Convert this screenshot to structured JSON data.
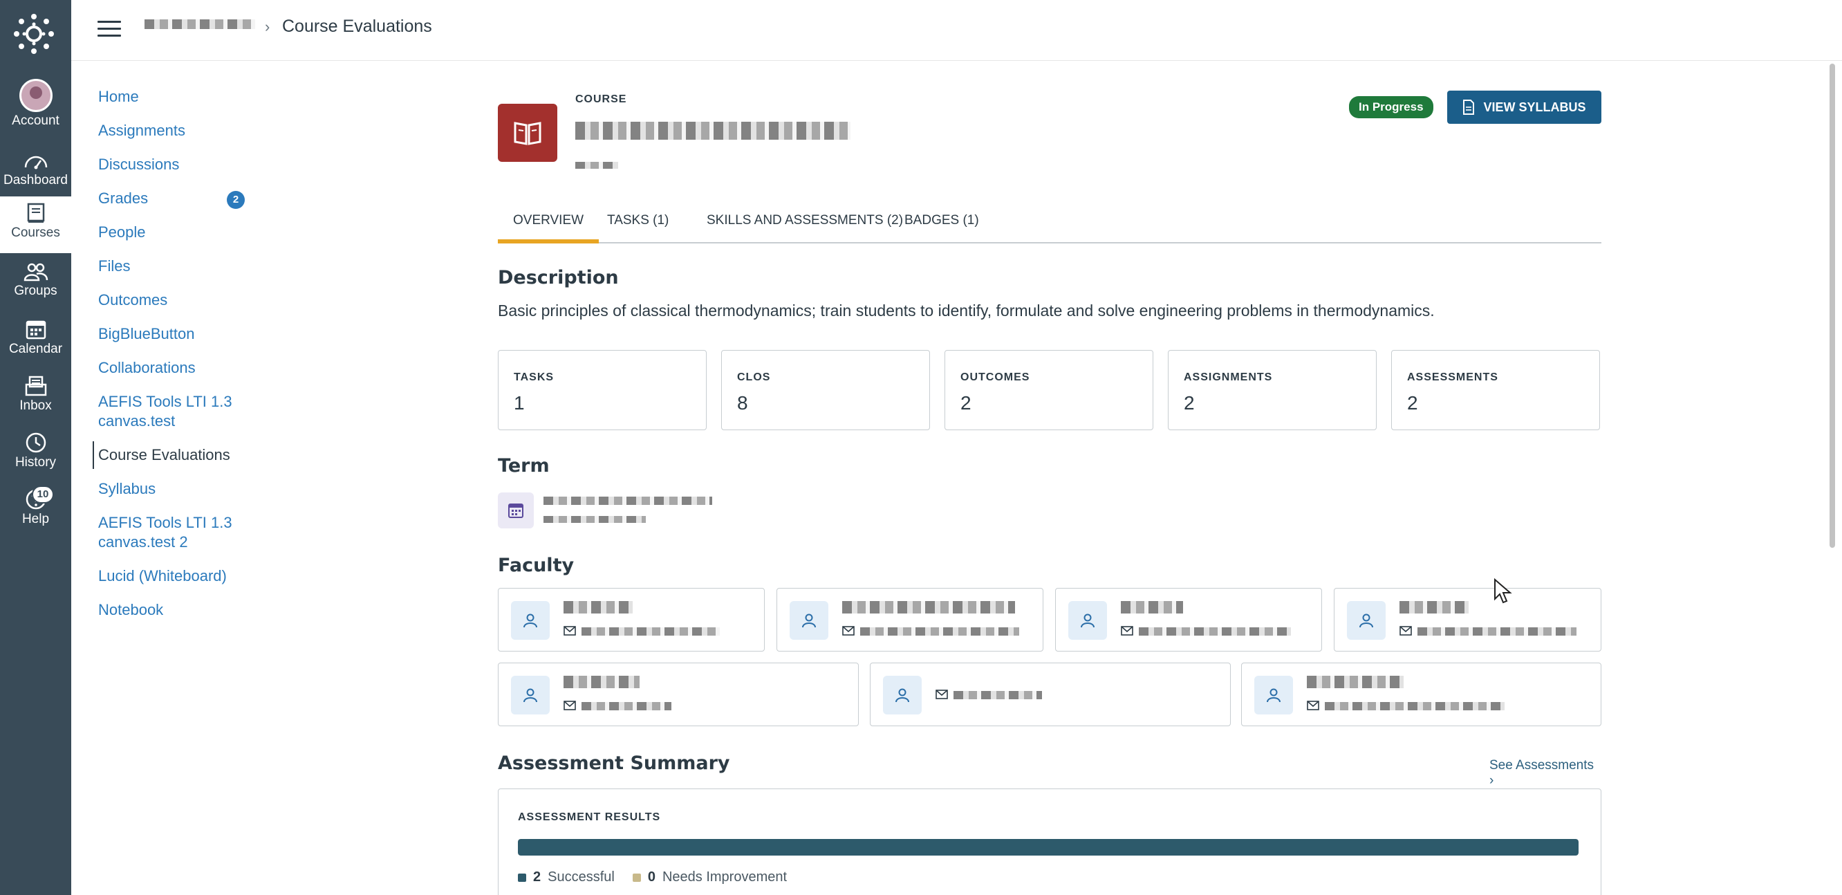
{
  "global_nav": {
    "items": [
      {
        "label": "Account",
        "icon": "avatar"
      },
      {
        "label": "Dashboard",
        "icon": "dashboard-icon"
      },
      {
        "label": "Courses",
        "icon": "courses-icon"
      },
      {
        "label": "Groups",
        "icon": "groups-icon"
      },
      {
        "label": "Calendar",
        "icon": "calendar-icon"
      },
      {
        "label": "Inbox",
        "icon": "inbox-icon"
      },
      {
        "label": "History",
        "icon": "history-icon"
      },
      {
        "label": "Help",
        "icon": "help-icon"
      }
    ],
    "help_badge": "10",
    "colors": {
      "background": "#394b58",
      "active_background": "#ffffff"
    }
  },
  "header": {
    "breadcrumb_separator": "›",
    "breadcrumb_current": "Course Evaluations"
  },
  "course_nav": {
    "items": [
      {
        "label": "Home"
      },
      {
        "label": "Assignments"
      },
      {
        "label": "Discussions"
      },
      {
        "label": "Grades",
        "badge": "2"
      },
      {
        "label": "People"
      },
      {
        "label": "Files"
      },
      {
        "label": "Outcomes"
      },
      {
        "label": "BigBlueButton"
      },
      {
        "label": "Collaborations"
      },
      {
        "label": "AEFIS Tools LTI 1.3 canvas.test"
      },
      {
        "label": "Course Evaluations",
        "active": true
      },
      {
        "label": "Syllabus"
      },
      {
        "label": "AEFIS Tools LTI 1.3 canvas.test 2"
      },
      {
        "label": "Lucid (Whiteboard)"
      },
      {
        "label": "Notebook"
      }
    ],
    "link_color": "#2b7abc"
  },
  "course": {
    "eyebrow": "COURSE",
    "status": "In Progress",
    "status_color": "#1f7a3b",
    "syllabus_button": "VIEW SYLLABUS",
    "icon_color": "#a3302d"
  },
  "tabs": [
    {
      "label": "OVERVIEW",
      "active": true
    },
    {
      "label": "TASKS (1)"
    },
    {
      "label": "SKILLS AND ASSESSMENTS (2)"
    },
    {
      "label": "BADGES (1)"
    }
  ],
  "description": {
    "title": "Description",
    "text": "Basic principles of classical thermodynamics; train students to identify, formulate and solve engineering problems in thermodynamics."
  },
  "stats": [
    {
      "label": "TASKS",
      "value": "1"
    },
    {
      "label": "CLOS",
      "value": "8"
    },
    {
      "label": "OUTCOMES",
      "value": "2"
    },
    {
      "label": "ASSIGNMENTS",
      "value": "2"
    },
    {
      "label": "ASSESSMENTS",
      "value": "2"
    }
  ],
  "term": {
    "title": "Term"
  },
  "faculty": {
    "title": "Faculty",
    "count": 7
  },
  "assessment_summary": {
    "title": "Assessment Summary",
    "see_link": "See Assessments ›",
    "results_label": "ASSESSMENT RESULTS",
    "successful_count": "2",
    "successful_label": "Successful",
    "needs_count": "0",
    "needs_label": "Needs Improvement",
    "successful_fraction": 1.0,
    "successful_color": "#2d5a6b",
    "needs_color": "#c8b98a"
  }
}
